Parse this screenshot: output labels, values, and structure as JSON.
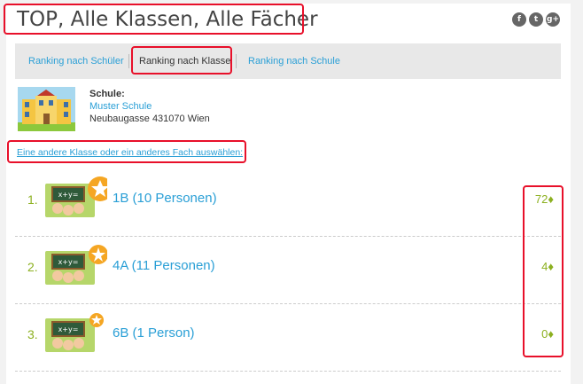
{
  "page": {
    "title": "TOP, Alle Klassen, Alle Fächer",
    "social": [
      {
        "icon": "facebook-icon",
        "glyph": "f"
      },
      {
        "icon": "twitter-icon",
        "glyph": "t"
      },
      {
        "icon": "google-plus-icon",
        "glyph": "g+"
      }
    ]
  },
  "tabs": [
    {
      "label": "Ranking nach Schüler",
      "active": false
    },
    {
      "label": "Ranking nach Klasse",
      "active": true
    },
    {
      "label": "Ranking nach Schule",
      "active": false
    }
  ],
  "school": {
    "label": "Schule:",
    "name": "Muster Schule",
    "address": "Neubaugasse 431070 Wien"
  },
  "change_link": "Eine andere Klasse oder ein anderes Fach auswählen:",
  "ranking": [
    {
      "rank": "1.",
      "class_label": "1B (10 Personen)",
      "score": "72♦"
    },
    {
      "rank": "2.",
      "class_label": "4A (11 Personen)",
      "score": "4♦"
    },
    {
      "rank": "3.",
      "class_label": "6B (1 Person)",
      "score": "0♦"
    }
  ],
  "colors": {
    "accent_link": "#2a9fd6",
    "score_green": "#8cb020",
    "highlight_red": "#e8102a",
    "star_orange": "#f5a623"
  }
}
